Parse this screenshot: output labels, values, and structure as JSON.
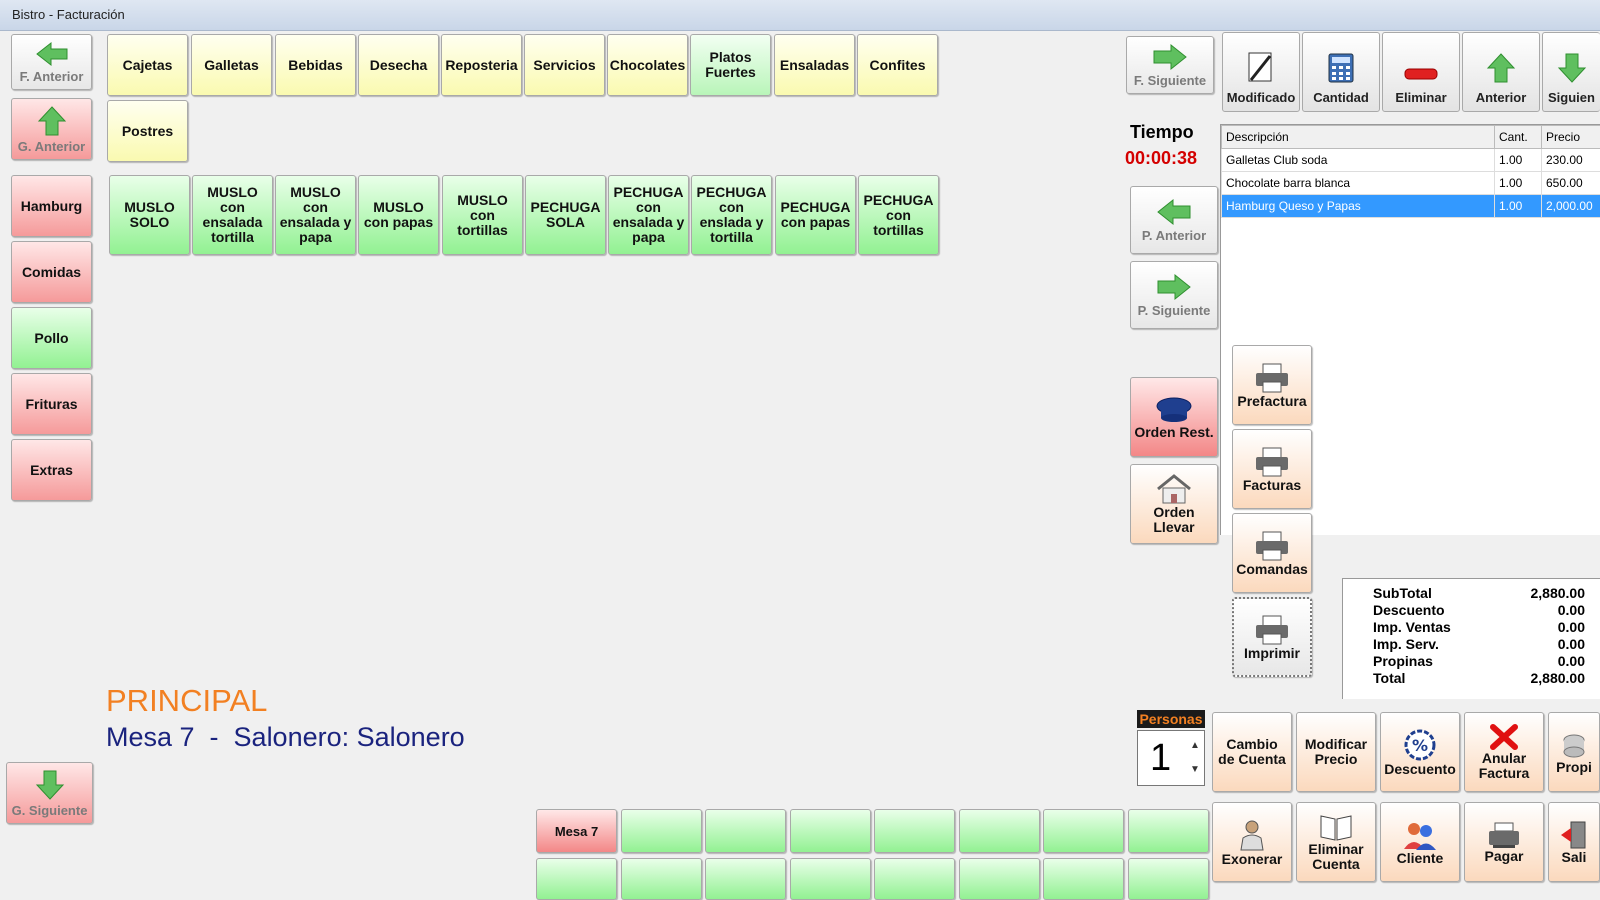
{
  "window": {
    "title": "Bistro - Facturación"
  },
  "nav": {
    "f_anterior": "F. Anterior",
    "g_anterior": "G. Anterior",
    "g_siguiente": "G. Siguiente",
    "f_siguiente": "F. Siguiente",
    "p_anterior": "P. Anterior",
    "p_siguiente": "P. Siguiente"
  },
  "groups": [
    "Hamburg",
    "Comidas",
    "Pollo",
    "Frituras",
    "Extras"
  ],
  "families": [
    "Cajetas",
    "Galletas",
    "Bebidas",
    "Desecha",
    "Reposteria",
    "Servicios",
    "Chocolates",
    "Platos Fuertes",
    "Ensaladas",
    "Confites",
    "Postres"
  ],
  "products": [
    "MUSLO SOLO",
    "MUSLO con ensalada tortilla",
    "MUSLO con ensalada y papa",
    "MUSLO con papas",
    "MUSLO con tortillas",
    "PECHUGA SOLA",
    "PECHUGA con ensalada y papa",
    "PECHUGA con enslada y tortilla",
    "PECHUGA con papas",
    "PECHUGA con tortillas"
  ],
  "toolbar": {
    "modificado": "Modificado",
    "cantidad": "Cantidad",
    "eliminar": "Eliminar",
    "anterior": "Anterior",
    "siguiente": "Siguien"
  },
  "tiempo": {
    "label": "Tiempo",
    "value": "00:00:38"
  },
  "order_grid": {
    "headers": [
      "Descripción",
      "Cant.",
      "Precio"
    ],
    "rows": [
      [
        "Galletas Club soda",
        "1.00",
        "230.00"
      ],
      [
        "Chocolate barra blanca",
        "1.00",
        "650.00"
      ],
      [
        "Hamburg Queso y Papas",
        "1.00",
        "2,000.00"
      ]
    ]
  },
  "orders": {
    "rest": "Orden Rest.",
    "llevar": "Orden Llevar"
  },
  "print": {
    "prefactura": "Prefactura",
    "facturas": "Facturas",
    "comandas": "Comandas",
    "imprimir": "Imprimir"
  },
  "totals": [
    [
      "SubTotal",
      "2,880.00"
    ],
    [
      "Descuento",
      "0.00"
    ],
    [
      "Imp. Ventas",
      "0.00"
    ],
    [
      "Imp. Serv.",
      "0.00"
    ],
    [
      "Propinas",
      "0.00"
    ],
    [
      "Total",
      "2,880.00"
    ]
  ],
  "context": {
    "section": "PRINCIPAL",
    "mesa_line": "Mesa 7  -  Salonero: Salonero"
  },
  "personas": {
    "label": "Personas",
    "value": "1"
  },
  "actions": {
    "cambio": "Cambio de Cuenta",
    "modificar_precio": "Modificar Precio",
    "descuento": "Descuento",
    "anular": "Anular Factura",
    "propina": "Propi",
    "exonerar": "Exonerar",
    "eliminar_cuenta": "Eliminar Cuenta",
    "cliente": "Cliente",
    "pagar": "Pagar",
    "salir": "Sali"
  },
  "tables": {
    "first": "Mesa 7"
  },
  "colors": {
    "accent_orange": "#f28022",
    "navy": "#1a237e",
    "timer_red": "#d40000",
    "selection": "#3399ff"
  }
}
